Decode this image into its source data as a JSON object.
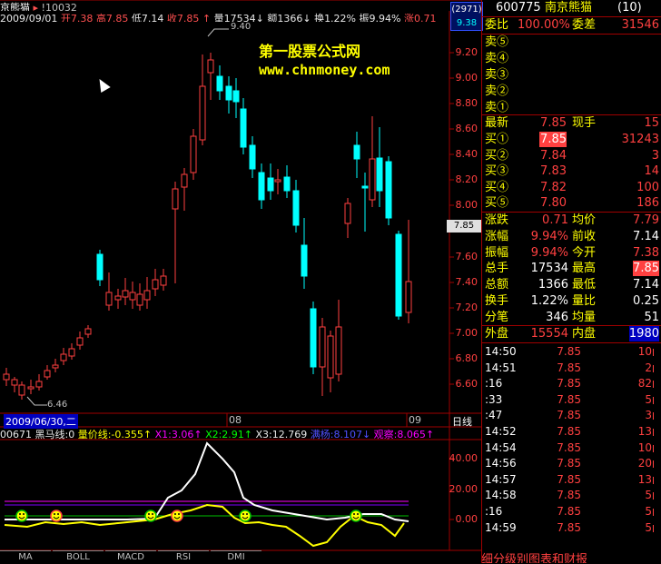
{
  "title_bar": {
    "stock": "京熊猫",
    "code": "!10032"
  },
  "info_bar": {
    "date": "2009/09/01",
    "open_label": "开",
    "open": "7.38",
    "high_label": "高",
    "high": "7.85",
    "low_label": "低",
    "low": "7.14",
    "close_label": "收",
    "close": "7.85",
    "vol_label": "量",
    "vol": "17534",
    "amt_label": "额",
    "amt": "1366",
    "turn_label": "换",
    "turn": "1.22%",
    "amp_label": "振",
    "amp": "9.94%",
    "chg_label": "涨",
    "chg": "0.71"
  },
  "axis_badge": {
    "top": "(2971)",
    "bottom": "9.38"
  },
  "current_price_badge": "7.85",
  "price_axis_labels": [
    "9.20",
    "9.00",
    "8.80",
    "8.60",
    "8.40",
    "8.20",
    "8.00",
    "7.60",
    "7.40",
    "7.20",
    "7.00",
    "6.80",
    "6.60"
  ],
  "watermark": {
    "line1": "第一股票公式网",
    "line2": "www.chnmoney.com"
  },
  "annotations": {
    "high": "9.40",
    "low": "6.46"
  },
  "date_axis": {
    "left": "2009/06/30,二",
    "mid": "08",
    "right": "09",
    "mode": "日线"
  },
  "indicator_bar": {
    "code": "00671",
    "name": "黑马线:0",
    "l1": "量价线:-0.355",
    "x1": "X1:3.06",
    "x2": "X2:2.91",
    "x3": "X3:12.769",
    "ex1": "满杨:8.107",
    "ex2": "观察:8.065"
  },
  "ind_axis_labels": [
    "40.00",
    "20.00",
    "0.00"
  ],
  "bottom_tabs": [
    "MA",
    "BOLL",
    "MACD",
    "RSI",
    "DMI"
  ],
  "panel": {
    "header_code": "600775",
    "header_name": "南京熊猫",
    "header_num": "(10)",
    "ratio_label": "委比",
    "ratio": "100.00%",
    "diff_label": "委差",
    "diff": "31546",
    "sells": [
      {
        "label": "卖⑤",
        "price": "",
        "vol": ""
      },
      {
        "label": "卖④",
        "price": "",
        "vol": ""
      },
      {
        "label": "卖③",
        "price": "",
        "vol": ""
      },
      {
        "label": "卖②",
        "price": "",
        "vol": ""
      },
      {
        "label": "卖①",
        "price": "",
        "vol": ""
      }
    ],
    "last_label": "最新",
    "last": "7.85",
    "now_vol_label": "现手",
    "now_vol": "15",
    "buys": [
      {
        "label": "买①",
        "price": "7.85",
        "vol": "31243"
      },
      {
        "label": "买②",
        "price": "7.84",
        "vol": "3"
      },
      {
        "label": "买③",
        "price": "7.83",
        "vol": "14"
      },
      {
        "label": "买④",
        "price": "7.82",
        "vol": "100"
      },
      {
        "label": "买⑤",
        "price": "7.80",
        "vol": "186"
      }
    ],
    "stats": [
      {
        "l1": "涨跌",
        "v1": "0.71",
        "l2": "均价",
        "v2": "7.79"
      },
      {
        "l1": "涨幅",
        "v1": "9.94%",
        "l2": "前收",
        "v2": "7.14"
      },
      {
        "l1": "振幅",
        "v1": "9.94%",
        "l2": "今开",
        "v2": "7.38"
      },
      {
        "l1": "总手",
        "v1": "17534",
        "l2": "最高",
        "v2": "7.85"
      },
      {
        "l1": "总额",
        "v1": "1366",
        "l2": "最低",
        "v2": "7.14"
      },
      {
        "l1": "换手",
        "v1": "1.22%",
        "l2": "量比",
        "v2": "0.25"
      },
      {
        "l1": "分笔",
        "v1": "346",
        "l2": "均量",
        "v2": "51"
      }
    ],
    "outer_label": "外盘",
    "outer": "15554",
    "inner_label": "内盘",
    "inner": "1980",
    "ticks": [
      {
        "t": "14:50",
        "p": "7.85",
        "v": "10"
      },
      {
        "t": "14:51",
        "p": "7.85",
        "v": "2"
      },
      {
        "t": ":16",
        "p": "7.85",
        "v": "82"
      },
      {
        "t": ":33",
        "p": "7.85",
        "v": "5"
      },
      {
        "t": ":47",
        "p": "7.85",
        "v": "3"
      },
      {
        "t": "14:52",
        "p": "7.85",
        "v": "13"
      },
      {
        "t": "14:54",
        "p": "7.85",
        "v": "10"
      },
      {
        "t": "14:56",
        "p": "7.85",
        "v": "20"
      },
      {
        "t": "14:57",
        "p": "7.85",
        "v": "13"
      },
      {
        "t": "14:58",
        "p": "7.85",
        "v": "5"
      },
      {
        "t": ":16",
        "p": "7.85",
        "v": "5"
      },
      {
        "t": "14:59",
        "p": "7.85",
        "v": "5"
      }
    ],
    "footer": "细分级别图表和财报"
  },
  "colors": {
    "up": "#ff4040",
    "down": "#00ffff",
    "axis": "#a00000",
    "label": "#ffff00"
  }
}
